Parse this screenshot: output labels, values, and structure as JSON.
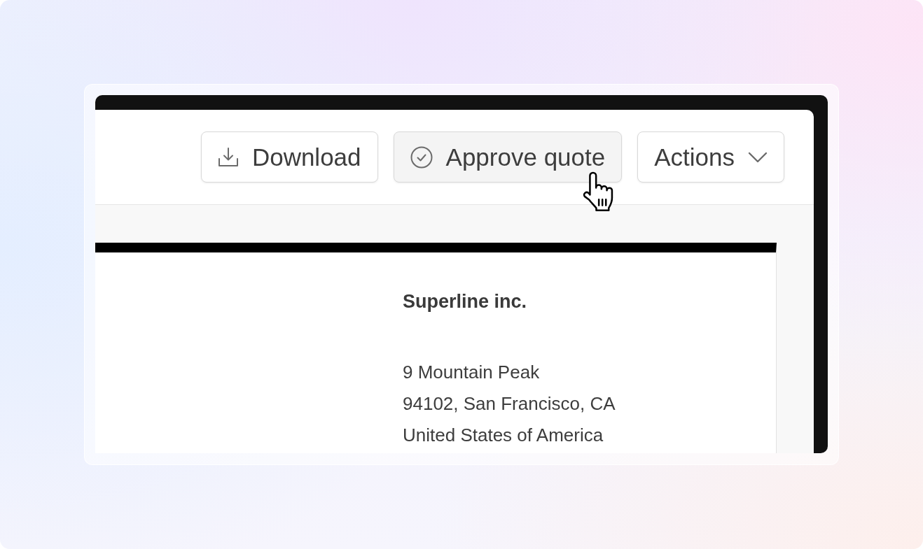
{
  "toolbar": {
    "buttons": [
      {
        "kind": "download",
        "label": "Download",
        "hovered": false
      },
      {
        "kind": "approve",
        "label": "Approve quote",
        "hovered": true
      },
      {
        "kind": "dropdown",
        "label": "Actions",
        "hovered": false
      }
    ]
  },
  "document": {
    "company": "Superline inc.",
    "address_lines": [
      "9 Mountain Peak",
      "94102, San Francisco, CA",
      "United States of America"
    ]
  }
}
